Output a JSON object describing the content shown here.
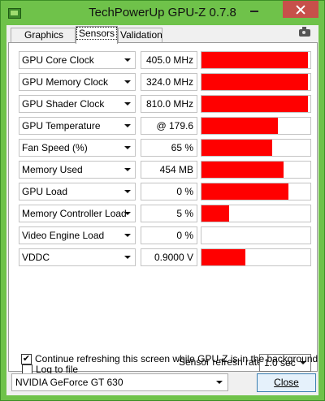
{
  "window": {
    "title": "TechPowerUp GPU-Z 0.7.8",
    "colors": {
      "frame": "#6fc24a",
      "close_button": "#c7504a",
      "graph": "#ff0000"
    }
  },
  "tabs": [
    {
      "label": "Graphics Card",
      "active": false
    },
    {
      "label": "Sensors",
      "active": true
    },
    {
      "label": "Validation",
      "active": false
    }
  ],
  "sensors": [
    {
      "label": "GPU Core Clock",
      "value": "405.0 MHz",
      "level": 0.98
    },
    {
      "label": "GPU Memory Clock",
      "value": "324.0 MHz",
      "level": 0.98
    },
    {
      "label": "GPU Shader Clock",
      "value": "810.0 MHz",
      "level": 0.98
    },
    {
      "label": "GPU Temperature",
      "value": "@ 179.6",
      "level": 0.7
    },
    {
      "label": "Fan Speed (%)",
      "value": "65 %",
      "level": 0.65
    },
    {
      "label": "Memory Used",
      "value": "454 MB",
      "level": 0.75
    },
    {
      "label": "GPU Load",
      "value": "0 %",
      "level": 0.8
    },
    {
      "label": "Memory Controller Load",
      "value": "5 %",
      "level": 0.25
    },
    {
      "label": "Video Engine Load",
      "value": "0 %",
      "level": 0.0
    },
    {
      "label": "VDDC",
      "value": "0.9000 V",
      "level": 0.4
    }
  ],
  "options": {
    "log_to_file": {
      "label": "Log to file",
      "checked": false
    },
    "continue_refresh": {
      "label": "Continue refreshing this screen while GPU-Z is in the background",
      "checked": true
    }
  },
  "refresh": {
    "label": "Sensor refresh rate:",
    "value": "1.0 sec"
  },
  "gpu_select": {
    "value": "NVIDIA GeForce GT 630"
  },
  "close_button": {
    "label": "Close"
  },
  "icons": {
    "app": "gpu-z-icon",
    "screenshot": "camera-icon"
  }
}
